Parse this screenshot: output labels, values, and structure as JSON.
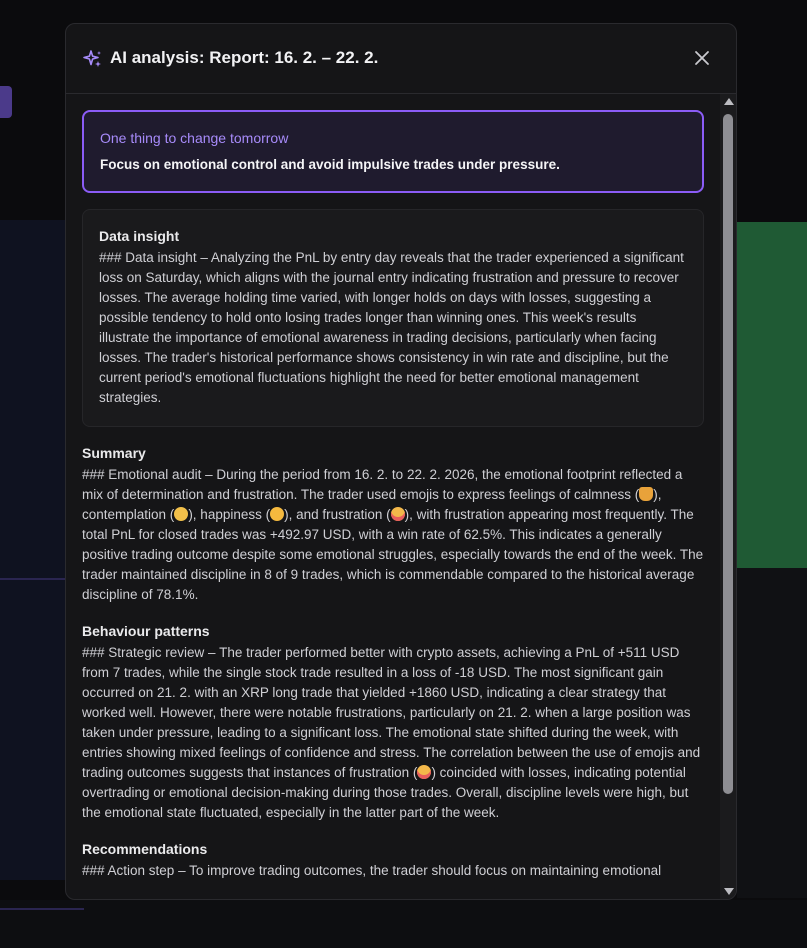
{
  "modal": {
    "title": "AI analysis: Report: 16. 2. – 22. 2.",
    "icons": {
      "title_icon": "sparkles-icon",
      "close_icon": "close-icon"
    },
    "accent_color": "#8b5cf6"
  },
  "highlight": {
    "label": "One thing to change tomorrow",
    "text": "Focus on emotional control and avoid impulsive trades under pressure."
  },
  "data_insight": {
    "title": "Data insight",
    "text": "### Data insight – Analyzing the PnL by entry day reveals that the trader experienced a significant loss on Saturday, which aligns with the journal entry indicating frustration and pressure to recover losses. The average holding time varied, with longer holds on days with losses, suggesting a possible tendency to hold onto losing trades longer than winning ones. This week's results illustrate the importance of emotional awareness in trading decisions, particularly when facing losses. The trader's historical performance shows consistency in win rate and discipline, but the current period's emotional fluctuations highlight the need for better emotional management strategies."
  },
  "summary": {
    "title": "Summary",
    "text_1": "### Emotional audit – During the period from 16. 2. to 22. 2. 2026, the emotional footprint reflected a mix of determination and frustration. The trader used emojis to express feelings of calmness (",
    "text_2": "), contemplation (",
    "text_3": "), happiness (",
    "text_4": "), and frustration (",
    "text_5": "), with frustration appearing most frequently. The total PnL for closed trades was +492.97 USD, with a win rate of 62.5%. This indicates a generally positive trading outcome despite some emotional struggles, especially towards the end of the week. The trader maintained discipline in 8 of 9 trades, which is commendable compared to the historical average discipline of 78.1%."
  },
  "behaviour": {
    "title": "Behaviour patterns",
    "text_1": "### Strategic review – The trader performed better with crypto assets, achieving a PnL of +511 USD from 7 trades, while the single stock trade resulted in a loss of -18 USD. The most significant gain occurred on 21. 2. with an XRP long trade that yielded +1860 USD, indicating a clear strategy that worked well. However, there were notable frustrations, particularly on 21. 2. when a large position was taken under pressure, leading to a significant loss. The emotional state shifted during the week, with entries showing mixed feelings of confidence and stress. The correlation between the use of emojis and trading outcomes suggests that instances of frustration (",
    "text_2": ") coincided with losses, indicating potential overtrading or emotional decision-making during those trades. Overall, discipline levels were high, but the emotional state fluctuated, especially in the latter part of the week."
  },
  "recommendations": {
    "title": "Recommendations",
    "text": "### Action step – To improve trading outcomes, the trader should focus on maintaining emotional"
  }
}
